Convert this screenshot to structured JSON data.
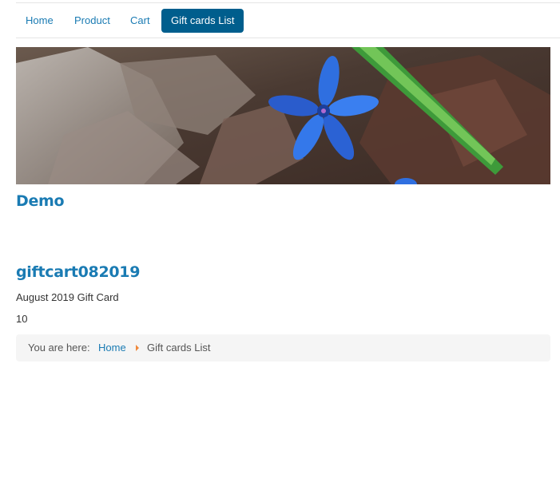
{
  "nav": {
    "items": [
      {
        "label": "Home",
        "active": false
      },
      {
        "label": "Product",
        "active": false
      },
      {
        "label": "Cart",
        "active": false
      },
      {
        "label": "Gift cards List",
        "active": true
      }
    ]
  },
  "site": {
    "title": "Demo"
  },
  "giftcard": {
    "title": "giftcart082019",
    "description": "August 2019 Gift Card",
    "value": "10"
  },
  "breadcrumb": {
    "prefix": "You are here:",
    "home": "Home",
    "current": "Gift cards List"
  },
  "colors": {
    "link": "#1a7bb3",
    "active_bg": "#005e8d",
    "separator": "#f0883a",
    "breadcrumb_bg": "#f5f5f5"
  }
}
